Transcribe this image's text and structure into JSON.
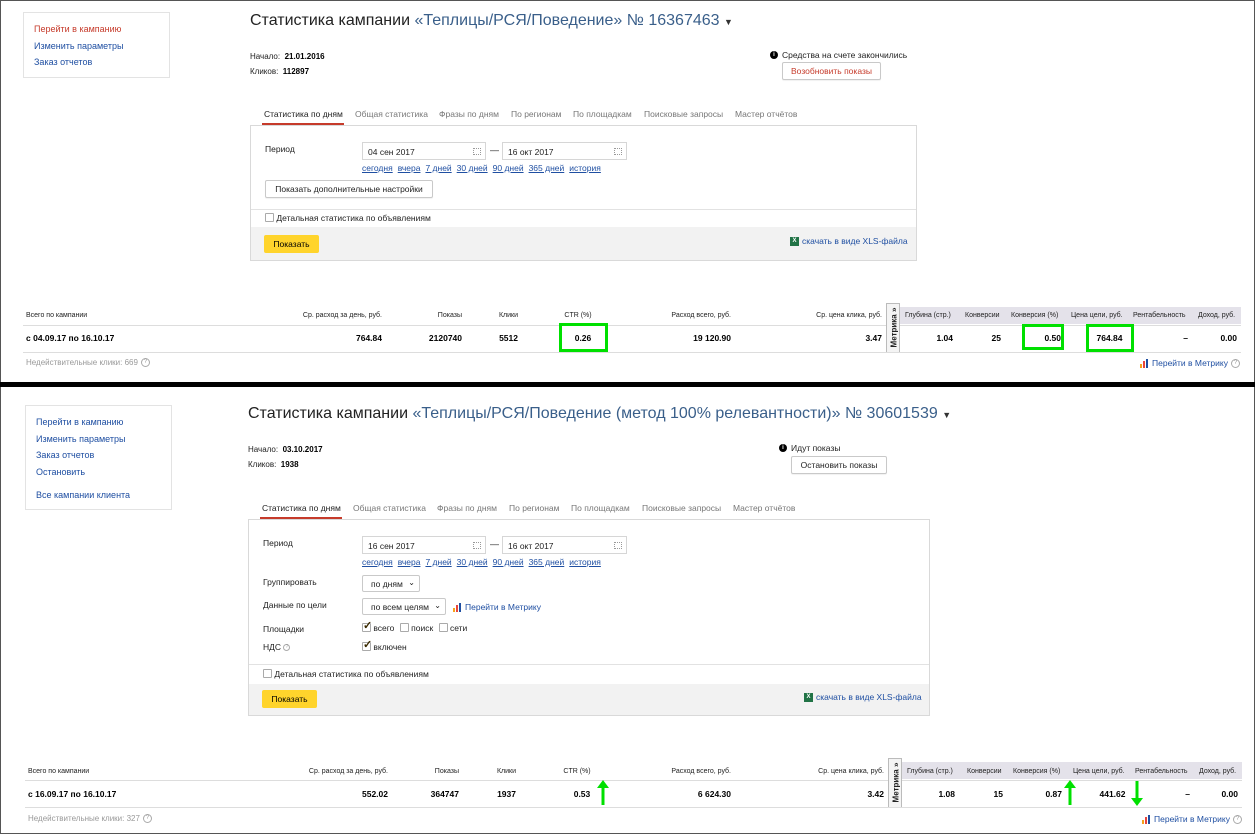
{
  "top": {
    "sidebar": [
      "Перейти в кампанию",
      "Изменить параметры",
      "Заказ отчетов"
    ],
    "title_prefix": "Статистика кампании",
    "campaign": "«Теплицы/РСЯ/Поведение»",
    "number": "№ 16367463",
    "start_label": "Начало:",
    "start_value": "21.01.2016",
    "clicks_label": "Кликов:",
    "clicks_value": "112897",
    "status": "Средства на счете закончились",
    "status_button": "Возобновить показы",
    "tabs": [
      "Статистика по дням",
      "Общая статистика",
      "Фразы по дням",
      "По регионам",
      "По площадкам",
      "Поисковые запросы",
      "Мастер отчётов"
    ],
    "period_label": "Период",
    "date_from": "04 сен 2017",
    "date_to": "16 окт 2017",
    "dash": "—",
    "quick": [
      "сегодня",
      "вчера",
      "7 дней",
      "30 дней",
      "90 дней",
      "365 дней",
      "история"
    ],
    "more_settings": "Показать дополнительные настройки",
    "detail_checkbox": "Детальная статистика по объявлениям",
    "show_button": "Показать",
    "xls": "скачать в виде XLS-файла",
    "summary": {
      "headers": [
        "Всего по кампании",
        "Ср. расход за день, руб.",
        "Показы",
        "Клики",
        "CTR (%)",
        "Расход всего, руб.",
        "Ср. цена клика, руб.",
        "Глубина (стр.)",
        "Конверсии",
        "Конверсия (%)",
        "Цена цели, руб.",
        "Рентабельность",
        "Доход, руб."
      ],
      "values": [
        "с 04.09.17 по 16.10.17",
        "764.84",
        "2120740",
        "5512",
        "0.26",
        "19 120.90",
        "3.47",
        "1.04",
        "25",
        "0.50",
        "764.84",
        "–",
        "0.00"
      ],
      "metrika": "Метрика »",
      "invalid_clicks": "Недействительные клики: 669",
      "metrika_link": "Перейти в Метрику"
    }
  },
  "bottom": {
    "sidebar": [
      "Перейти в кампанию",
      "Изменить параметры",
      "Заказ отчетов",
      "Остановить",
      "Все кампании клиента"
    ],
    "title_prefix": "Статистика кампании",
    "campaign": "«Теплицы/РСЯ/Поведение (метод 100% релевантности)»",
    "number": "№ 30601539",
    "start_label": "Начало:",
    "start_value": "03.10.2017",
    "clicks_label": "Кликов:",
    "clicks_value": "1938",
    "status": "Идут показы",
    "status_button": "Остановить показы",
    "tabs": [
      "Статистика по дням",
      "Общая статистика",
      "Фразы по дням",
      "По регионам",
      "По площадкам",
      "Поисковые запросы",
      "Мастер отчётов"
    ],
    "period_label": "Период",
    "date_from": "16 сен 2017",
    "date_to": "16 окт 2017",
    "dash": "—",
    "quick": [
      "сегодня",
      "вчера",
      "7 дней",
      "30 дней",
      "90 дней",
      "365 дней",
      "история"
    ],
    "group_label": "Группировать",
    "group_value": "по дням",
    "goal_label": "Данные по цели",
    "goal_value": "по всем целям",
    "metrika_link_form": "Перейти в Метрику",
    "places_label": "Площадки",
    "places": [
      "всего",
      "поиск",
      "сети"
    ],
    "vat_label": "НДС",
    "vat_value": "включен",
    "detail_checkbox": "Детальная статистика по объявлениям",
    "show_button": "Показать",
    "xls": "скачать в виде XLS-файла",
    "summary": {
      "headers": [
        "Всего по кампании",
        "Ср. расход за день, руб.",
        "Показы",
        "Клики",
        "CTR (%)",
        "Расход всего, руб.",
        "Ср. цена клика, руб.",
        "Глубина (стр.)",
        "Конверсии",
        "Конверсия (%)",
        "Цена цели, руб.",
        "Рентабельность",
        "Доход, руб."
      ],
      "values": [
        "с 16.09.17 по 16.10.17",
        "552.02",
        "364747",
        "1937",
        "0.53",
        "6 624.30",
        "3.42",
        "1.08",
        "15",
        "0.87",
        "441.62",
        "–",
        "0.00"
      ],
      "metrika": "Метрика »",
      "invalid_clicks": "Недействительные клики: 327",
      "metrika_link": "Перейти в Метрику"
    }
  },
  "colors": {
    "highlight": "#00e000",
    "link": "#1f4fa2",
    "accent_red": "#c63b2b",
    "button_yellow": "#ffd42c"
  }
}
